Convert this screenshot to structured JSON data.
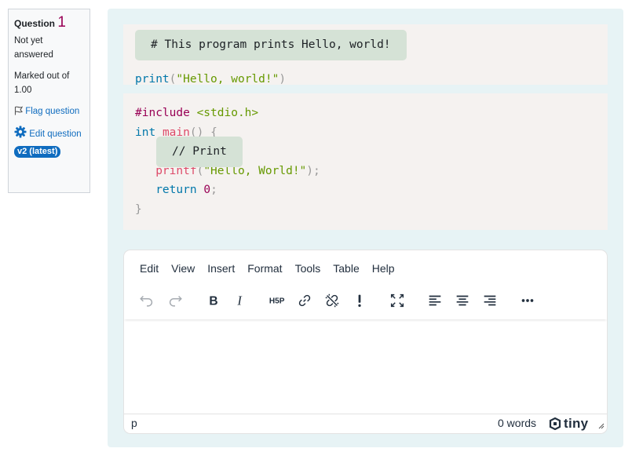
{
  "question_info": {
    "label": "Question",
    "number": "1",
    "state": "Not yet answered",
    "grade": "Marked out of 1.00",
    "flag_label": "Flag question",
    "edit_label": "Edit question",
    "version_badge": "v2 (latest)"
  },
  "code_block_1": {
    "line1": {
      "fn": "print",
      "open": "(",
      "str": "\"Hello, world!\"",
      "close": ")"
    },
    "tooltip": "# This program prints Hello, world!"
  },
  "code_block_2": {
    "include": "#include",
    "header": "<stdio.h>",
    "type": "int",
    "fname": "main",
    "parens": "()",
    "brace_open": "{",
    "printf_fn": "printf",
    "printf_open": "(",
    "printf_str": "\"Hello, World!\"",
    "printf_close": ");",
    "return_kw": "return",
    "return_val": "0",
    "semicolon": ";",
    "brace_close": "}",
    "tooltip": "// Print"
  },
  "editor": {
    "menu": [
      "Edit",
      "View",
      "Insert",
      "Format",
      "Tools",
      "Table",
      "Help"
    ],
    "toolbar": [
      "undo-icon",
      "redo-icon",
      "bold-icon",
      "italic-icon",
      "h5p-icon",
      "link-icon",
      "unlink-icon",
      "exclamation-icon",
      "fullscreen-icon",
      "align-left-icon",
      "align-center-icon",
      "align-right-icon",
      "more-icon"
    ],
    "status_path": "p",
    "word_count": "0 words",
    "brand": "tiny"
  },
  "colors": {
    "accent": "#0f6cbf",
    "formulation_bg": "#e7f3f5",
    "code_bg": "#f5f2f0",
    "tooltip_bg": "#d5e2d6"
  }
}
